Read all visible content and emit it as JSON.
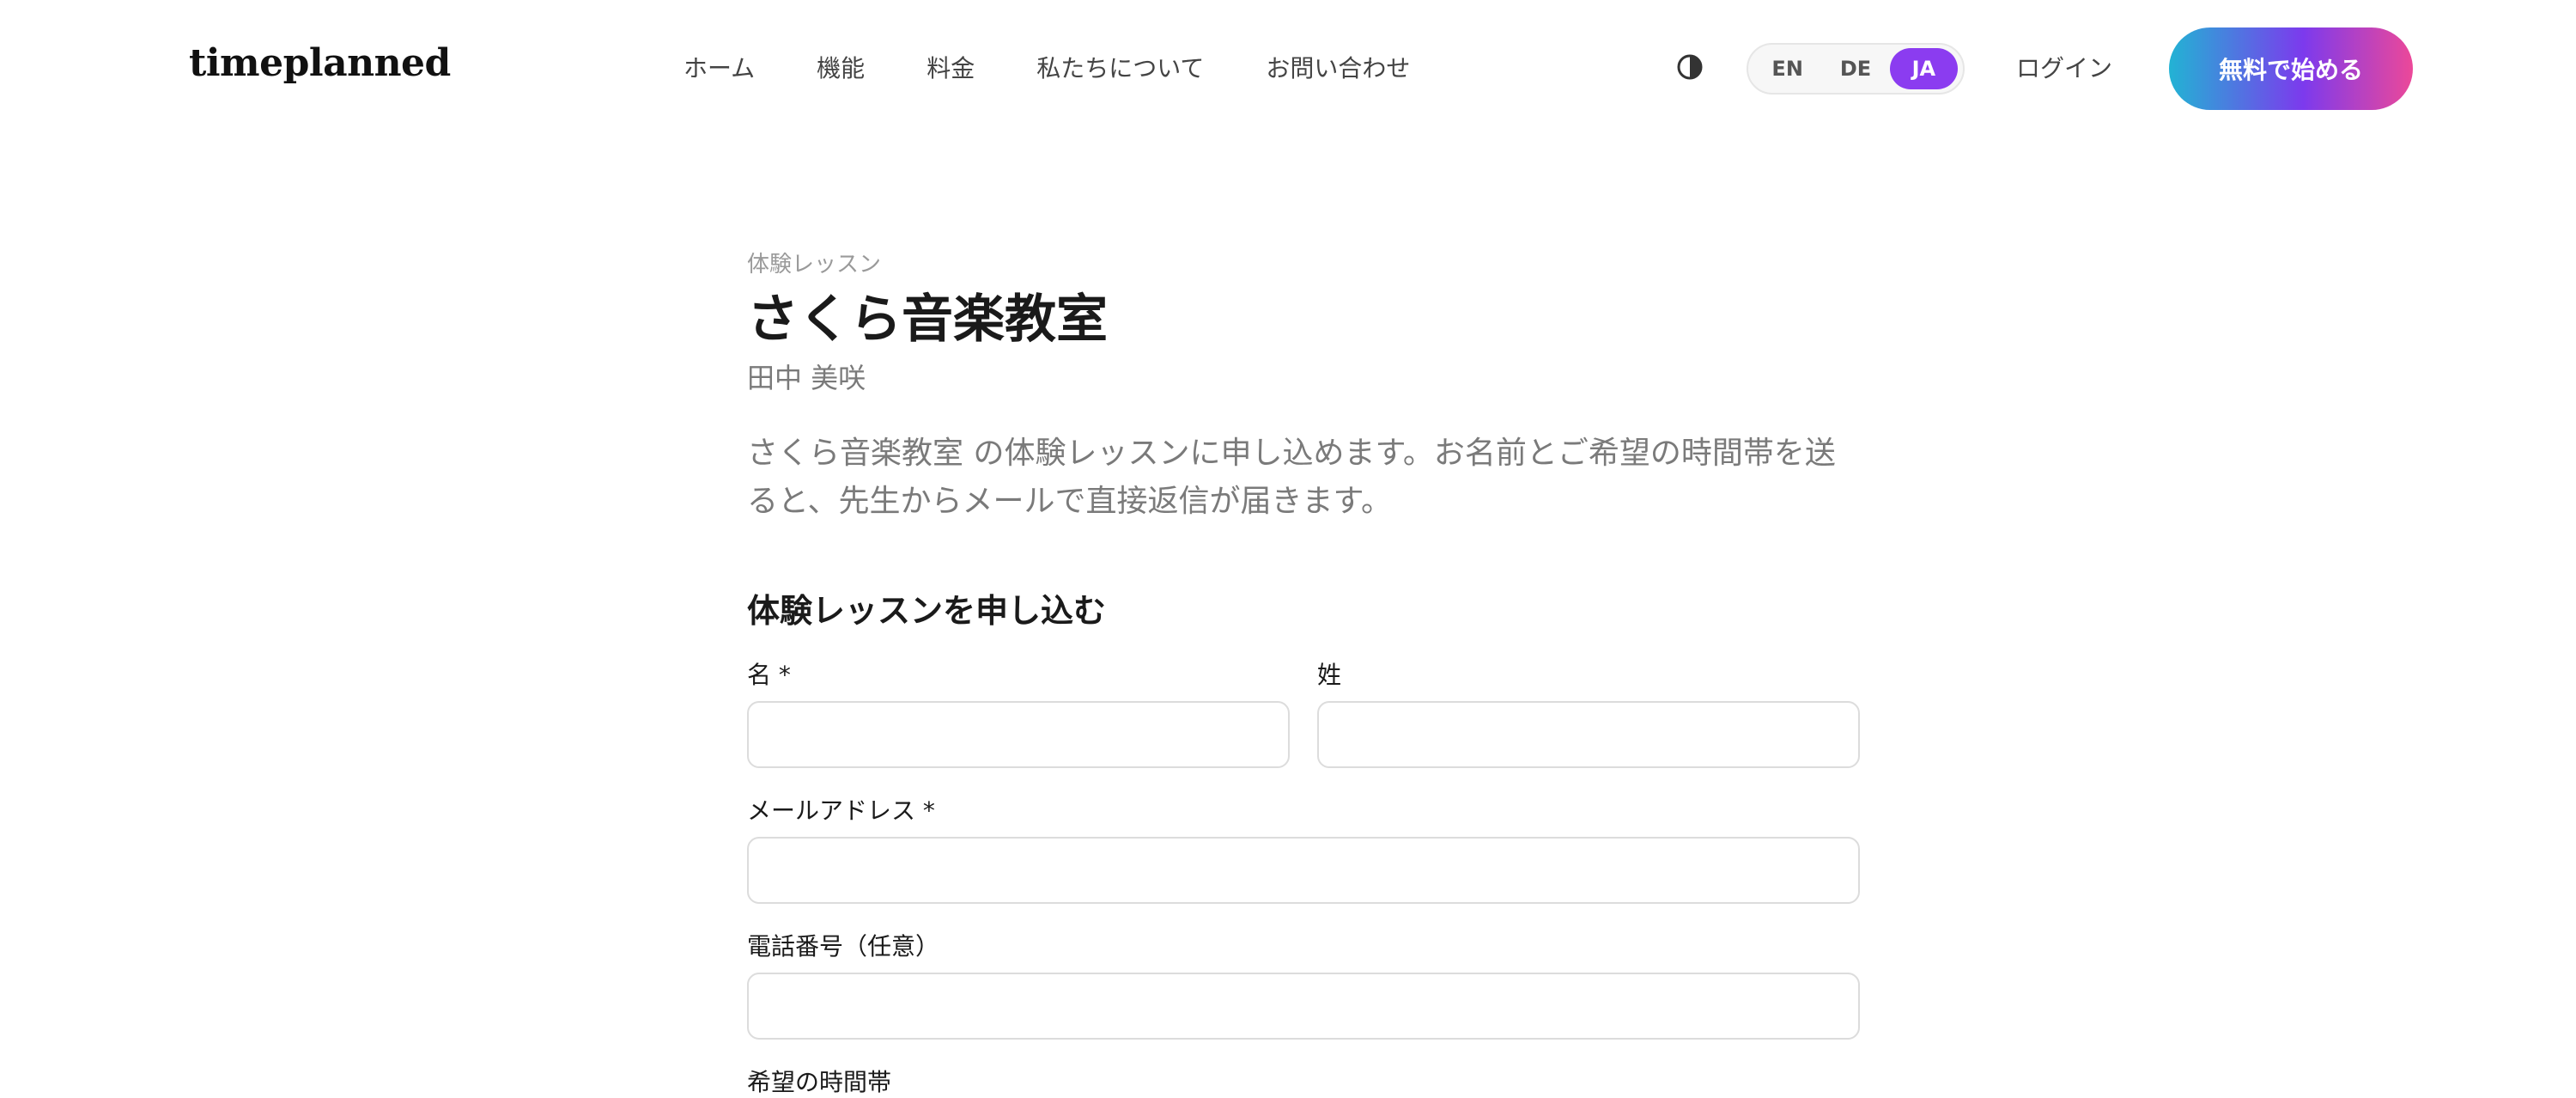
{
  "header": {
    "logo": "timeplanned",
    "nav": [
      {
        "label": "ホーム"
      },
      {
        "label": "機能"
      },
      {
        "label": "料金"
      },
      {
        "label": "私たちについて"
      },
      {
        "label": "お問い合わせ"
      }
    ],
    "theme_icon": "half-circle-contrast-icon",
    "languages": [
      {
        "label": "EN"
      },
      {
        "label": "DE"
      },
      {
        "label": "JA"
      }
    ],
    "selected_language": "JA",
    "login": "ログイン",
    "cta": "無料で始める"
  },
  "page": {
    "eyebrow": "体験レッスン",
    "title": "さくら音楽教室",
    "teacher": "田中 美咲",
    "description": "さくら音楽教室 の体験レッスンに申し込めます。お名前とご希望の時間帯を送ると、先生からメールで直接返信が届きます。"
  },
  "form": {
    "title": "体験レッスンを申し込む",
    "first_name_label": "名 *",
    "last_name_label": "姓",
    "email_label": "メールアドレス *",
    "phone_label": "電話番号（任意）",
    "preferred_time_label": "希望の時間帯",
    "first_name_value": "",
    "last_name_value": "",
    "email_value": "",
    "phone_value": ""
  },
  "colors": {
    "accent": "#8b3cf0",
    "cta_gradient_start": "#22b3d4",
    "cta_gradient_mid": "#7c3aed",
    "cta_gradient_end": "#ec4899"
  }
}
